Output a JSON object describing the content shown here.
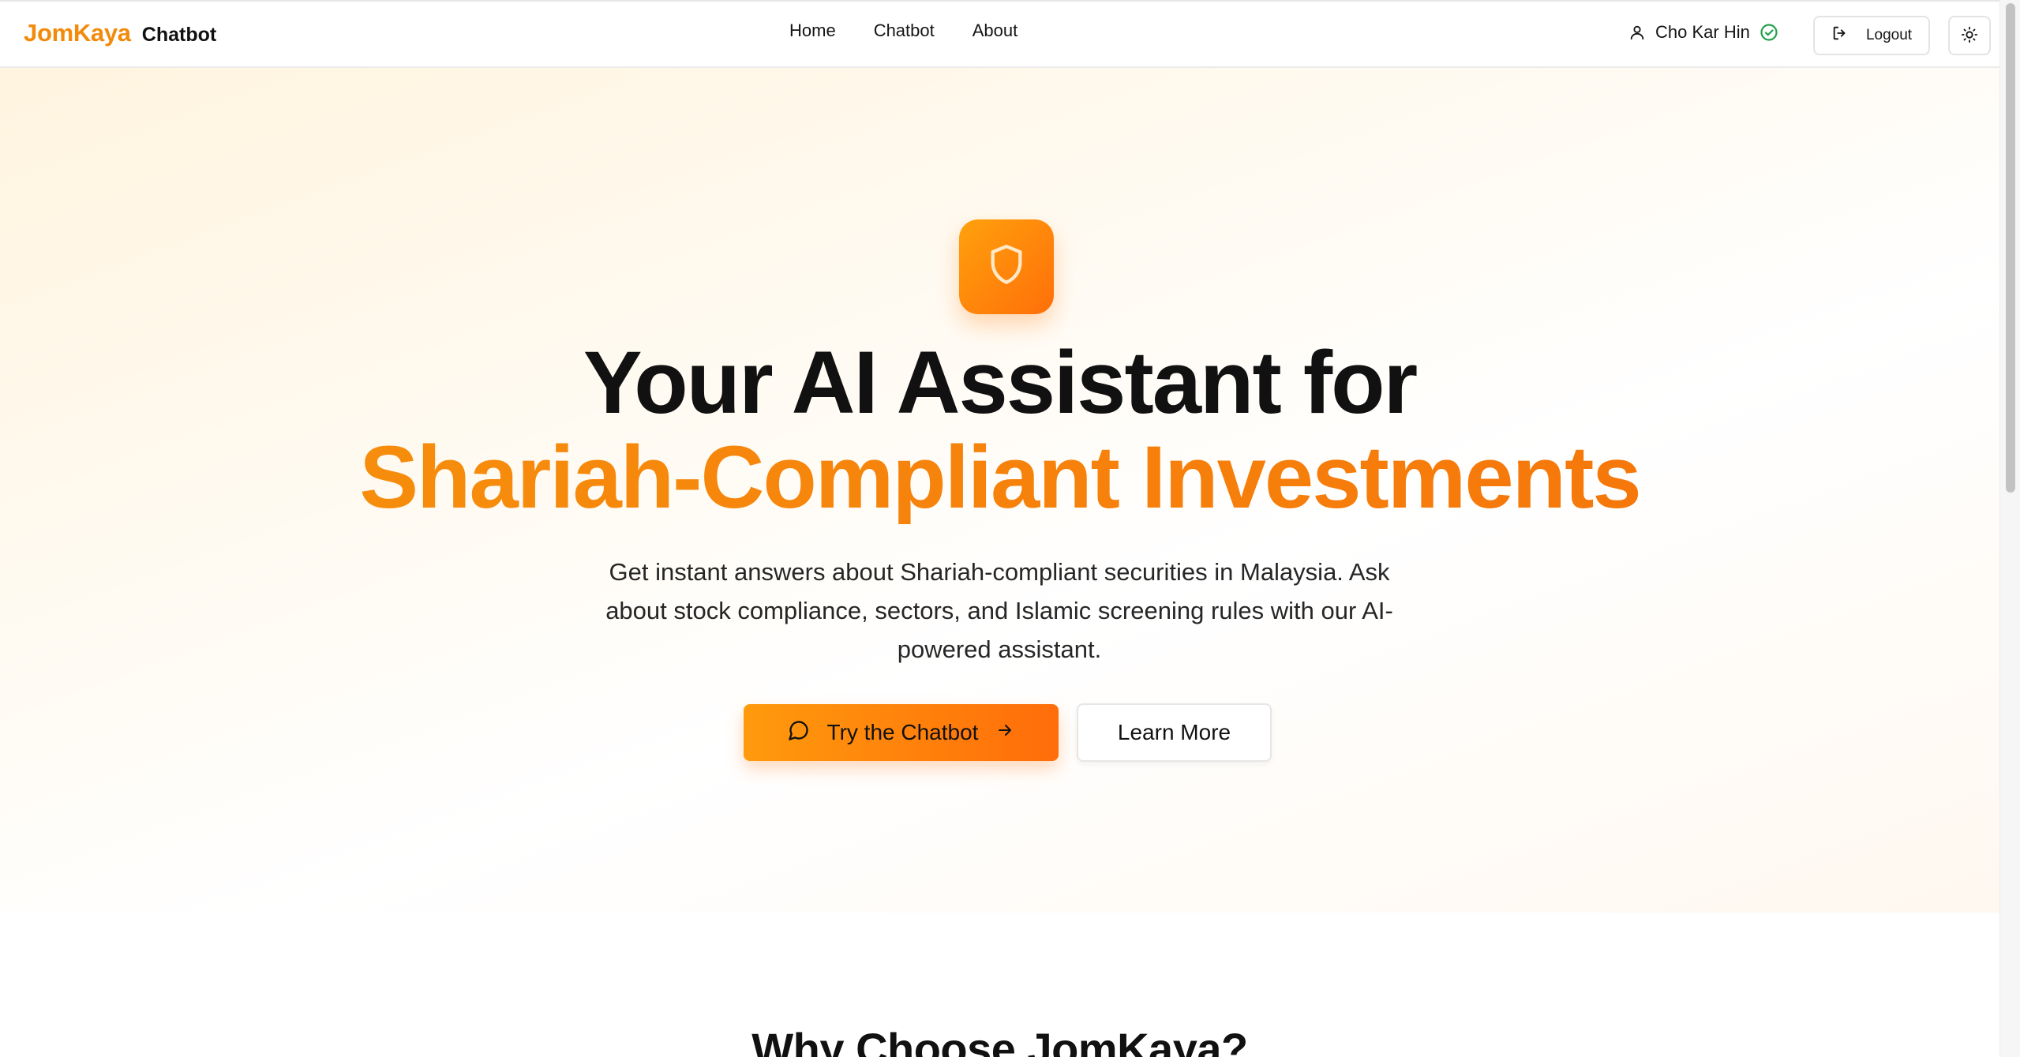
{
  "brand": {
    "name": "JomKaya",
    "product": "Chatbot"
  },
  "nav": {
    "links": [
      "Home",
      "Chatbot",
      "About"
    ]
  },
  "user": {
    "name": "Cho Kar Hin",
    "verified": true,
    "icon": "user-icon",
    "verified_icon": "check-circle-icon"
  },
  "header_actions": {
    "logout_label": "Logout",
    "logout_icon": "logout-icon",
    "theme_icon": "sun-icon"
  },
  "hero": {
    "icon": "shield-icon",
    "title": "Your AI Assistant for",
    "title_accent": "Shariah-Compliant Investments",
    "description": "Get instant answers about Shariah-compliant securities in Malaysia. Ask about stock compliance, sectors, and Islamic screening rules with our AI-powered assistant.",
    "primary_cta": {
      "label": "Try the Chatbot",
      "icon": "message-circle-icon",
      "trailing_icon": "arrow-right-icon"
    },
    "secondary_cta": {
      "label": "Learn More"
    }
  },
  "features": {
    "title": "Why Choose JomKaya?"
  },
  "colors": {
    "accent": "#f28a0c",
    "accent_dark": "#ff6d0a",
    "verified": "#22a04b",
    "text": "#111111"
  }
}
